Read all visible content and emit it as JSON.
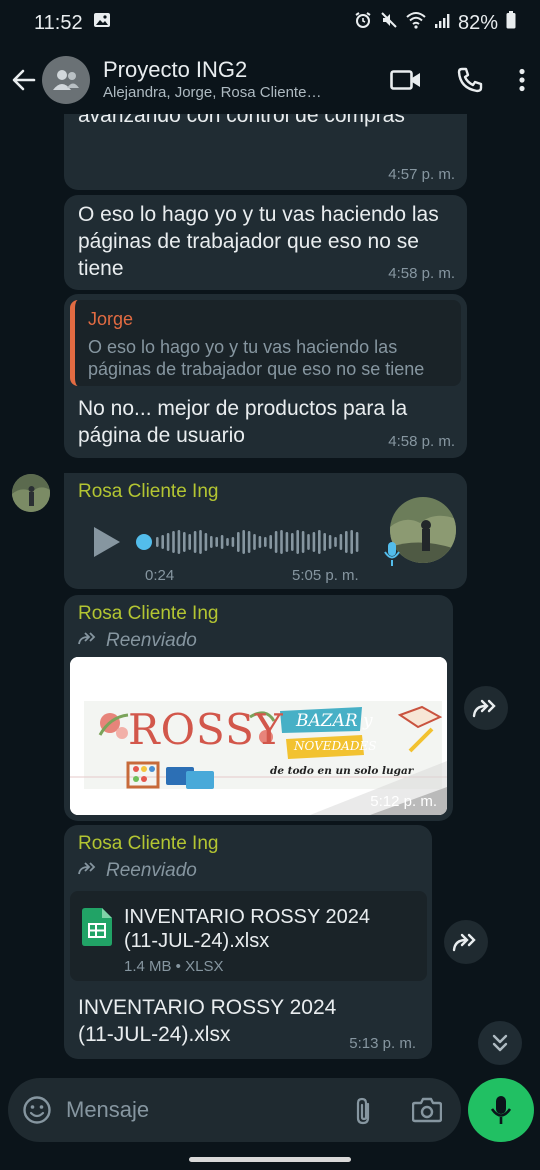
{
  "status_bar": {
    "time": "11:52",
    "battery": "82%"
  },
  "header": {
    "title": "Proyecto ING2",
    "subtitle": "Alejandra, Jorge, Rosa Cliente…"
  },
  "messages": [
    {
      "text": "Yap, entonces si puedes anda avanzando con control de compras",
      "time": "4:57 p. m."
    },
    {
      "text": "O eso lo hago yo y tu vas haciendo las páginas de trabajador que eso no se tiene",
      "time": "4:58 p. m."
    },
    {
      "quote_author": "Jorge",
      "quote_text": "O eso lo hago yo y tu vas haciendo las páginas de trabajador que eso no se tiene",
      "text": "No no... mejor de productos para la página de usuario",
      "time": "4:58 p. m."
    },
    {
      "sender": "Rosa Cliente Ing",
      "duration": "0:24",
      "time": "5:05 p. m.",
      "played_fraction": 0.0
    },
    {
      "sender": "Rosa Cliente Ing",
      "forwarded_label": "Reenviado",
      "image_text": {
        "brand": "ROSSY",
        "banner": "BAZAR y",
        "banner2": "NOVEDADES",
        "tagline": "de todo en un solo lugar"
      },
      "time": "5:12 p. m."
    },
    {
      "sender": "Rosa Cliente Ing",
      "forwarded_label": "Reenviado",
      "file_name": "INVENTARIO ROSSY 2024 (11-JUL-24).xlsx",
      "file_meta": "1.4 MB • XLSX",
      "caption": "INVENTARIO ROSSY 2024 (11-JUL-24).xlsx",
      "time": "5:13 p. m."
    }
  ],
  "composer": {
    "placeholder": "Mensaje"
  },
  "colors": {
    "background": "#0b141a",
    "bubble": "#202c33",
    "sender_name": "#b3c532",
    "quote_author": "#e26b42",
    "mic_button": "#21c063",
    "audio_dot": "#53bdeb"
  },
  "icons": {
    "back": "back-arrow-icon",
    "video": "video-call-icon",
    "call": "phone-icon",
    "menu": "more-vert-icon",
    "play": "play-icon",
    "forward": "forward-icon",
    "emoji": "emoji-icon",
    "attach": "attach-icon",
    "camera": "camera-icon",
    "mic": "mic-icon",
    "scroll": "scroll-down-icon"
  }
}
